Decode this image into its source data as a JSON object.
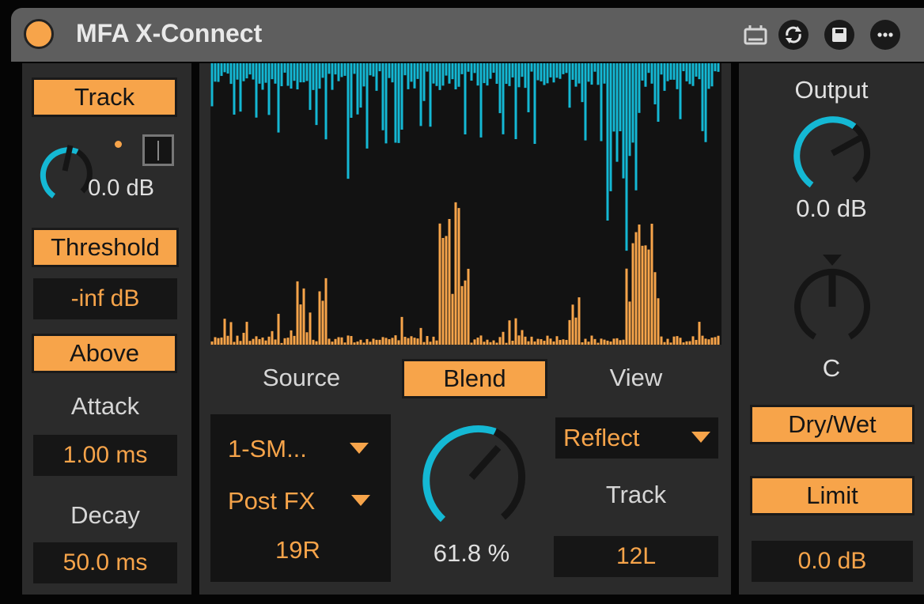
{
  "title": "MFA X-Connect",
  "colors": {
    "accent": "#f7a44a",
    "cyan": "#14b8d4",
    "panel": "#2b2b2b",
    "titlebar": "#5e5e5e"
  },
  "left": {
    "track_label": "Track",
    "gain_value": "0.0 dB",
    "threshold_label": "Threshold",
    "threshold_value": "-inf dB",
    "above_label": "Above",
    "attack_label": "Attack",
    "attack_value": "1.00 ms",
    "decay_label": "Decay",
    "decay_value": "50.0 ms"
  },
  "center": {
    "source_label": "Source",
    "source_select": "1-SM...",
    "tap_select": "Post FX",
    "source_channel": "19R",
    "blend_label": "Blend",
    "blend_value": "61.8 %",
    "view_label": "View",
    "view_select": "Reflect",
    "track_label": "Track",
    "track_channel": "12L"
  },
  "right": {
    "output_label": "Output",
    "output_value": "0.0 dB",
    "pan_value": "C",
    "drywet_label": "Dry/Wet",
    "limit_label": "Limit",
    "limit_value": "0.0 dB"
  },
  "icons": [
    "power-icon",
    "midi-map-icon",
    "refresh-icon",
    "save-icon",
    "more-icon"
  ]
}
